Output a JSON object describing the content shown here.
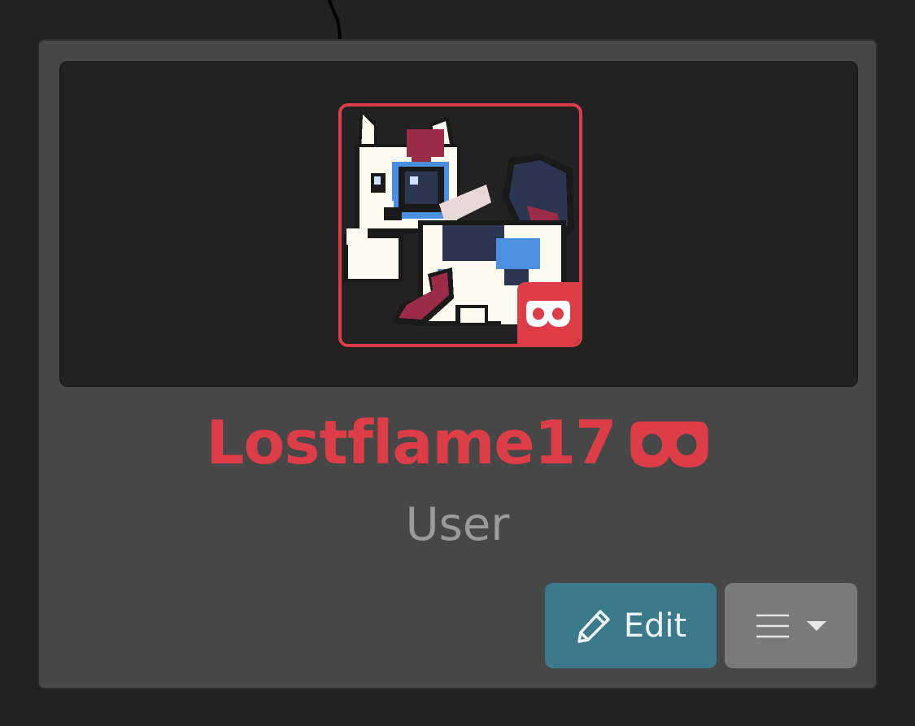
{
  "profile": {
    "username": "Lostflame17",
    "role": "User",
    "avatar_icon": "fox-pixel-art-avatar",
    "badge_icon": "mask-icon"
  },
  "actions": {
    "edit_label": "Edit",
    "edit_icon": "pencil-icon",
    "menu_icon": "hamburger-menu-icon",
    "menu_caret_icon": "caret-down-icon"
  },
  "colors": {
    "page_background": "#222222",
    "card_background": "#474747",
    "accent": "#dc3d47",
    "edit_button": "#3b7a8a",
    "menu_button": "#7a7a7a",
    "role_text": "#9b9b9b"
  }
}
